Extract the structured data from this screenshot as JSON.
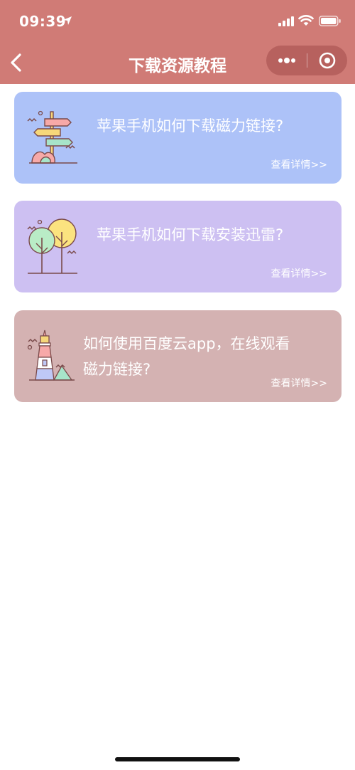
{
  "status_bar": {
    "time": "09:39"
  },
  "nav": {
    "title": "下载资源教程"
  },
  "cards": [
    {
      "text": "苹果手机如何下载磁力链接?",
      "link": "查看详情>>",
      "bg": "#adc2f8",
      "icon": "signpost-icon"
    },
    {
      "text": "苹果手机如何下载安装迅雷?",
      "link": "查看详情>>",
      "bg": "#cdc0f2",
      "icon": "trees-icon"
    },
    {
      "text": "如何使用百度云app，在线观看磁力链接?",
      "link": "查看详情>>",
      "bg": "#d4b2b2",
      "icon": "lighthouse-icon"
    }
  ],
  "colors": {
    "header": "#d07b76",
    "capsule": "#b7615e"
  }
}
